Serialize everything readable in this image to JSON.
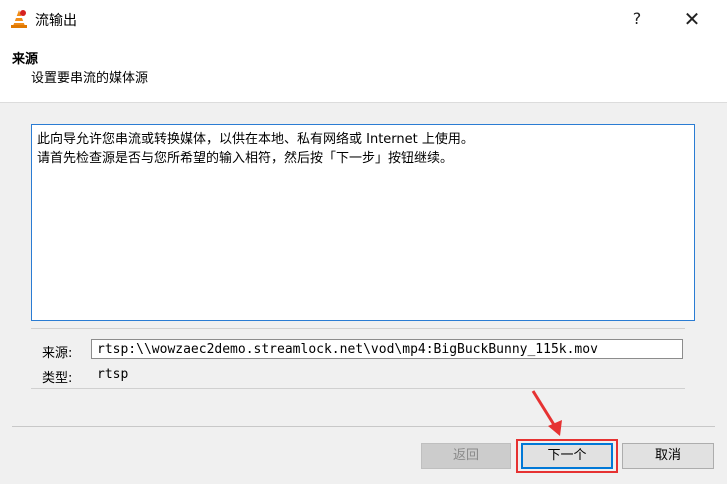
{
  "window": {
    "title": "流输出",
    "help_glyph": "?",
    "close_glyph": "✕"
  },
  "header": {
    "title": "来源",
    "subtitle": "设置要串流的媒体源"
  },
  "info": {
    "line1": "此向导允许您串流或转换媒体，以供在本地、私有网络或 Internet 上使用。",
    "line2": "请首先检查源是否与您所希望的输入相符，然后按「下一步」按钮继续。"
  },
  "source": {
    "label": "来源:",
    "value": "rtsp:\\\\wowzaec2demo.streamlock.net\\vod\\mp4:BigBuckBunny_115k.mov"
  },
  "type": {
    "label": "类型:",
    "value": "rtsp"
  },
  "buttons": {
    "back": "返回",
    "next": "下一个",
    "cancel": "取消"
  },
  "colors": {
    "accent": "#0078d7",
    "highlight": "#e63232",
    "focus_border": "#2a7cd3"
  },
  "icons": {
    "app": "vlc-cone-icon",
    "annotation": "red-arrow-icon"
  }
}
